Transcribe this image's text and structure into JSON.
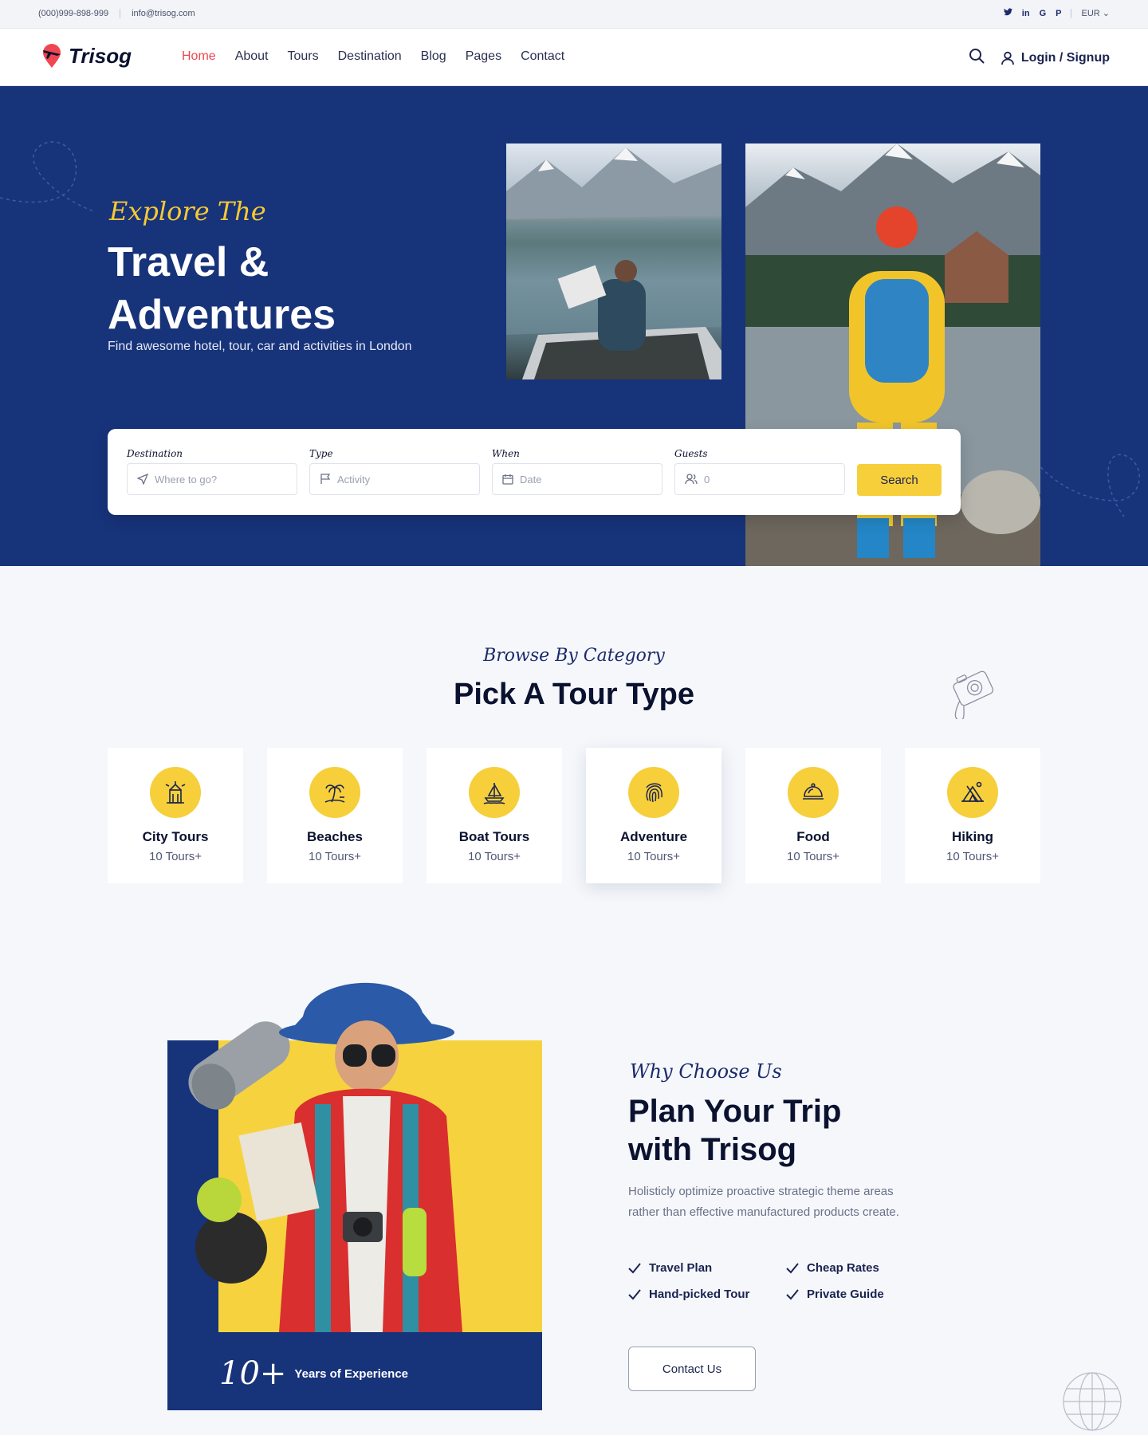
{
  "topbar": {
    "phone": "(000)999-898-999",
    "email": "info@trisog.com",
    "social": [
      "twitter",
      "linkedin",
      "google",
      "pinterest"
    ],
    "currency": "EUR"
  },
  "header": {
    "logo": "Trisog",
    "nav": [
      "Home",
      "About",
      "Tours",
      "Destination",
      "Blog",
      "Pages",
      "Contact"
    ],
    "active_nav": "Home",
    "login": "Login / Signup"
  },
  "hero": {
    "script": "Explore The",
    "title_line1": "Travel &",
    "title_line2": "Adventures",
    "subtitle": "Find awesome hotel, tour, car and activities in London"
  },
  "search": {
    "fields": [
      {
        "label": "Destination",
        "placeholder": "Where to go?",
        "icon": "send-icon"
      },
      {
        "label": "Type",
        "placeholder": "Activity",
        "icon": "flag-icon"
      },
      {
        "label": "When",
        "placeholder": "Date",
        "icon": "calendar-icon"
      },
      {
        "label": "Guests",
        "placeholder": "0",
        "icon": "users-icon"
      }
    ],
    "button": "Search"
  },
  "categories": {
    "script": "Browse By Category",
    "title": "Pick A Tour Type",
    "items": [
      {
        "name": "City Tours",
        "count": "10 Tours+",
        "icon": "building-icon"
      },
      {
        "name": "Beaches",
        "count": "10 Tours+",
        "icon": "palm-tree-icon"
      },
      {
        "name": "Boat Tours",
        "count": "10 Tours+",
        "icon": "sailboat-icon"
      },
      {
        "name": "Adventure",
        "count": "10 Tours+",
        "icon": "fingerprint-icon"
      },
      {
        "name": "Food",
        "count": "10 Tours+",
        "icon": "cloche-icon"
      },
      {
        "name": "Hiking",
        "count": "10 Tours+",
        "icon": "tent-icon"
      }
    ]
  },
  "why": {
    "script": "Why Choose Us",
    "title_line1": "Plan Your Trip",
    "title_line2": "with Trisog",
    "text": "Holisticly optimize proactive strategic theme areas rather than effective manufactured products create.",
    "features": [
      "Travel Plan",
      "Cheap Rates",
      "Hand-picked Tour",
      "Private Guide"
    ],
    "button": "Contact Us",
    "exp_number": "10+",
    "exp_text": "Years of Experience"
  },
  "colors": {
    "navy": "#17337a",
    "yellow": "#f6cf3b",
    "accent_red": "#f0464f"
  }
}
